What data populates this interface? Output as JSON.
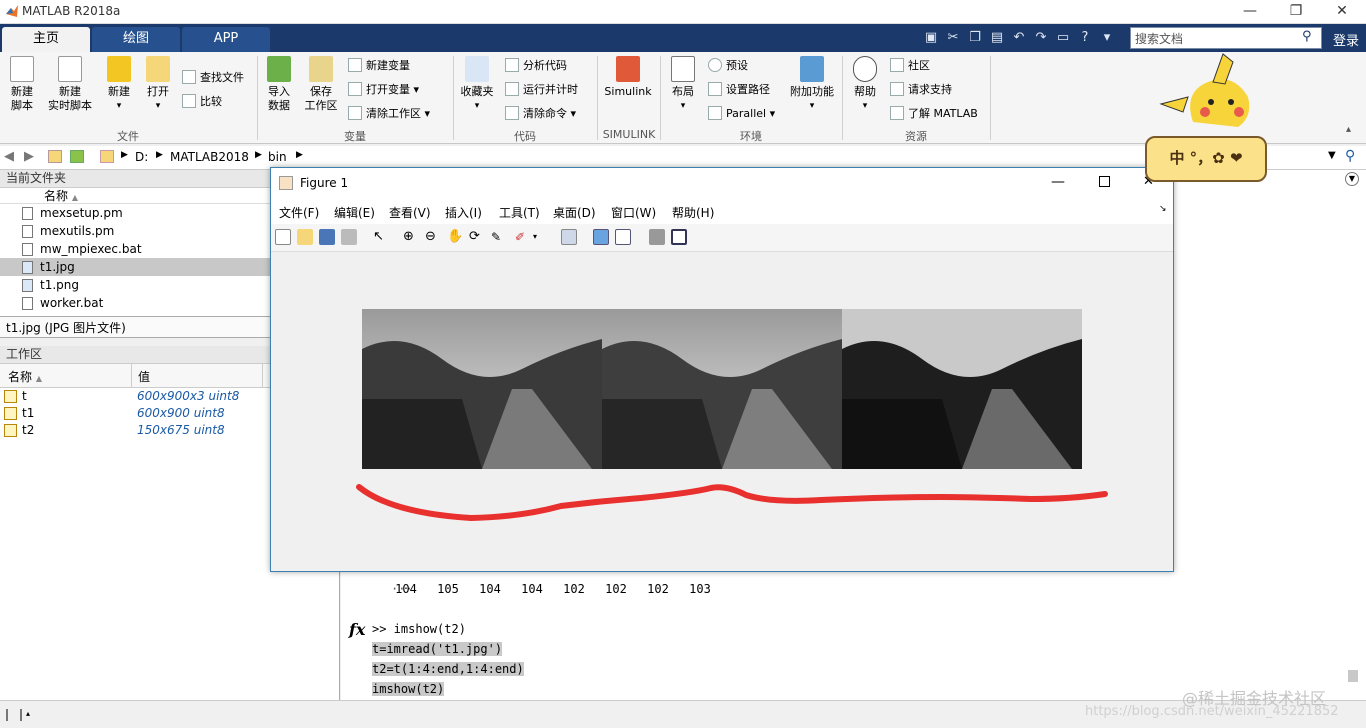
{
  "app": {
    "title": "MATLAB R2018a"
  },
  "window_controls": {
    "minimize": "—",
    "maximize": "❐",
    "close": "✕"
  },
  "tabs": [
    "主页",
    "绘图",
    "APP"
  ],
  "search": {
    "placeholder": "搜索文档"
  },
  "login_label": "登录",
  "ribbon": {
    "file": {
      "new_script": "新建\n脚本",
      "new_live": "新建\n实时脚本",
      "new": "新建",
      "open": "打开",
      "find_files": "查找文件",
      "compare": "比较",
      "group": "文件"
    },
    "variable": {
      "import": "导入\n数据",
      "save_ws": "保存\n工作区",
      "new_var": "新建变量",
      "open_var": "打开变量",
      "clear_ws": "清除工作区",
      "group": "变量"
    },
    "code": {
      "favorites": "收藏夹",
      "analyze": "分析代码",
      "run_time": "运行并计时",
      "clear_cmd": "清除命令",
      "group": "代码"
    },
    "simulink": {
      "label": "Simulink",
      "group": "SIMULINK"
    },
    "env": {
      "layout": "布局",
      "prefs": "预设",
      "set_path": "设置路径",
      "parallel": "Parallel",
      "addons": "附加功能",
      "group": "环境"
    },
    "resources": {
      "help": "帮助",
      "community": "社区",
      "support": "请求支持",
      "learn": "了解 MATLAB",
      "group": "资源"
    }
  },
  "address": {
    "drive": "D:",
    "folder1": "MATLAB2018",
    "folder2": "bin"
  },
  "current_folder": {
    "title": "当前文件夹",
    "col_name": "名称",
    "files": [
      "mexsetup.pm",
      "mexutils.pm",
      "mw_mpiexec.bat",
      "t1.jpg",
      "t1.png",
      "worker.bat"
    ],
    "selected_index": 3,
    "detail": "t1.jpg  (JPG 图片文件)"
  },
  "workspace": {
    "title": "工作区",
    "col_name": "名称",
    "col_value": "值",
    "vars": [
      {
        "name": "t",
        "value": "600x900x3 uint8"
      },
      {
        "name": "t1",
        "value": "600x900 uint8"
      },
      {
        "name": "t2",
        "value": "150x675 uint8"
      }
    ]
  },
  "figure": {
    "title": "Figure 1",
    "menu": [
      "文件(F)",
      "编辑(E)",
      "查看(V)",
      "插入(I)",
      "工具(T)",
      "桌面(D)",
      "窗口(W)",
      "帮助(H)"
    ]
  },
  "command": {
    "numbers": [
      "104",
      "105",
      "104",
      "104",
      "102",
      "102",
      "102",
      "103"
    ],
    "prompt": ">> imshow(t2)",
    "history": [
      "t=imread('t1.jpg')",
      "t2=t(1:4:end,1:4:end)",
      "imshow(t2)"
    ],
    "fx": "fx"
  },
  "ime": {
    "text": "中 °，✿ ❤"
  },
  "watermark": {
    "line1": "@稀土掘金技术社区",
    "line2": "https://blog.csdn.net/weixin_45221852"
  }
}
